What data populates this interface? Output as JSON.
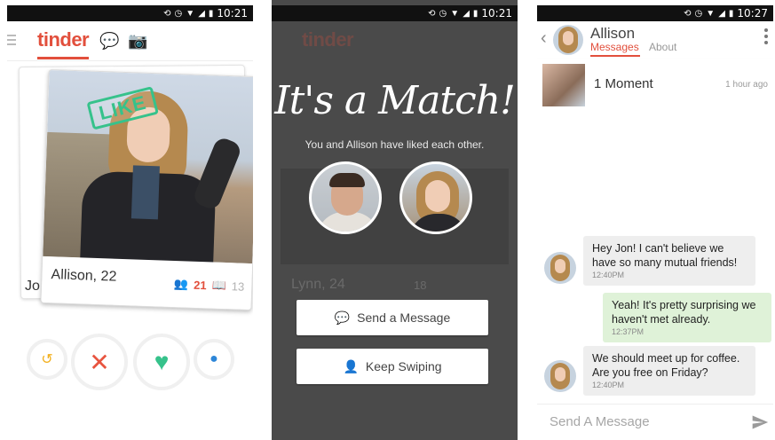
{
  "colors": {
    "accent": "#e24f3c",
    "like_green": "#36c28b",
    "match_bg": "#4a4a4a",
    "sent_bubble": "#dff2d8"
  },
  "status_bar": {
    "time": "10:21",
    "icons": [
      "sync-icon",
      "alarm-icon",
      "wifi-icon",
      "signal-icon",
      "battery-icon"
    ]
  },
  "phone1": {
    "logo": "tinder",
    "like_stamp": "LIKE",
    "card": {
      "name": "Allison, 22",
      "mutual_friends": "21",
      "mutual_interests": "13"
    },
    "back_card_name": "Jo",
    "actions": [
      "undo-icon",
      "dislike-icon",
      "like-icon",
      "boost-location-icon"
    ]
  },
  "phone2": {
    "logo": "tinder",
    "title": "It's a Match!",
    "subtitle": "You and Allison have liked each other.",
    "ghost_name": "Lynn, 24",
    "ghost_stats": "18",
    "send_message_label": "Send a Message",
    "keep_swiping_label": "Keep Swiping"
  },
  "phone3": {
    "status_time": "10:27",
    "contact_name": "Allison",
    "tab_messages": "Messages",
    "tab_about": "About",
    "moment_label": "1 Moment",
    "moment_time": "1 hour ago",
    "messages": [
      {
        "from": "Allison",
        "text": "Hey Jon! I can't believe we have so many mutual friends!",
        "time": "12:40PM"
      },
      {
        "from": "me",
        "text": "Yeah! It's pretty surprising we haven't met already.",
        "time": "12:37PM"
      },
      {
        "from": "Allison",
        "text": "We should meet up for coffee. Are you free on Friday?",
        "time": "12:40PM"
      }
    ],
    "compose_placeholder": "Send A Message"
  }
}
